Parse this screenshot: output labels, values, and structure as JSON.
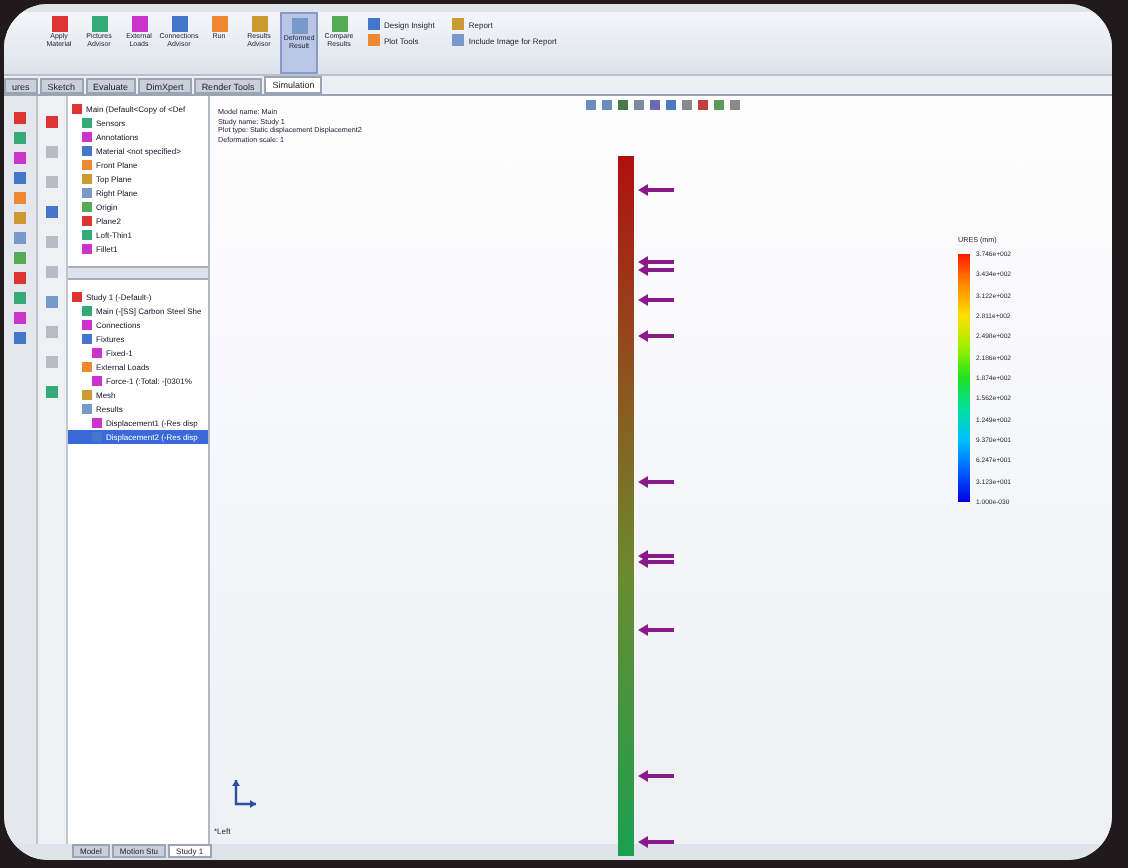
{
  "ribbon": {
    "buttons": [
      {
        "label": "Apply Material"
      },
      {
        "label": "Pictures Advisor"
      },
      {
        "label": "External Loads"
      },
      {
        "label": "Connections Advisor"
      },
      {
        "label": "Run"
      },
      {
        "label": "Results Advisor"
      },
      {
        "label": "Deformed Result",
        "selected": true
      },
      {
        "label": "Compare Results",
        "selected": false
      }
    ],
    "small_buttons": [
      "Design Insight",
      "Plot Tools",
      "Report",
      "Include Image for Report"
    ]
  },
  "tabs": [
    {
      "label": "ures",
      "selected": false
    },
    {
      "label": "Sketch",
      "selected": false
    },
    {
      "label": "Evaluate",
      "selected": false
    },
    {
      "label": "DimXpert",
      "selected": false
    },
    {
      "label": "Render Tools",
      "selected": false
    },
    {
      "label": "Simulation",
      "selected": true
    }
  ],
  "feature_tree": [
    {
      "label": "Main  (Default<Copy of <Def",
      "children": [
        {
          "label": "Sensors"
        },
        {
          "label": "Annotations"
        },
        {
          "label": "Material <not specified>"
        },
        {
          "label": "Front Plane"
        },
        {
          "label": "Top Plane"
        },
        {
          "label": "Right Plane"
        },
        {
          "label": "Origin"
        },
        {
          "label": "Plane2"
        },
        {
          "label": "Loft-Thin1"
        },
        {
          "label": "Fillet1"
        }
      ]
    }
  ],
  "study_tree": [
    {
      "label": "Study 1 (-Default-)",
      "selected": false,
      "children": [
        {
          "label": "Main (-[SS] Carbon Steel She",
          "selected": false
        },
        {
          "label": "Connections",
          "selected": false
        },
        {
          "label": "Fixtures",
          "selected": false,
          "children": [
            {
              "label": "Fixed-1",
              "selected": false
            }
          ]
        },
        {
          "label": "External Loads",
          "selected": false,
          "children": [
            {
              "label": "Force-1 (:Total: -[0301%",
              "selected": false
            }
          ]
        },
        {
          "label": "Mesh",
          "selected": false
        },
        {
          "label": "Results",
          "selected": false,
          "children": [
            {
              "label": "Displacement1 (-Res disp",
              "selected": false
            },
            {
              "label": "Displacement2 (-Res disp",
              "selected": true
            }
          ]
        }
      ]
    }
  ],
  "viewport": {
    "info": [
      "Model name: Main",
      "Study name: Study 1",
      "Plot type: Static displacement Displacement2",
      "Deformation scale: 1"
    ],
    "view_label": "*Left",
    "legend": {
      "title": "URES (mm)",
      "values": [
        "3.746e+002",
        "3.434e+002",
        "3.122e+002",
        "2.811e+002",
        "2.498e+002",
        "2.186e+002",
        "1.874e+002",
        "1.562e+002",
        "1.249e+002",
        "9.370e+001",
        "6.247e+001",
        "3.123e+001",
        "1.000e-030"
      ]
    }
  },
  "bottom_tabs": [
    {
      "label": "Model",
      "selected": false
    },
    {
      "label": "Motion Stu",
      "selected": false
    },
    {
      "label": "Study 1",
      "selected": true
    }
  ]
}
